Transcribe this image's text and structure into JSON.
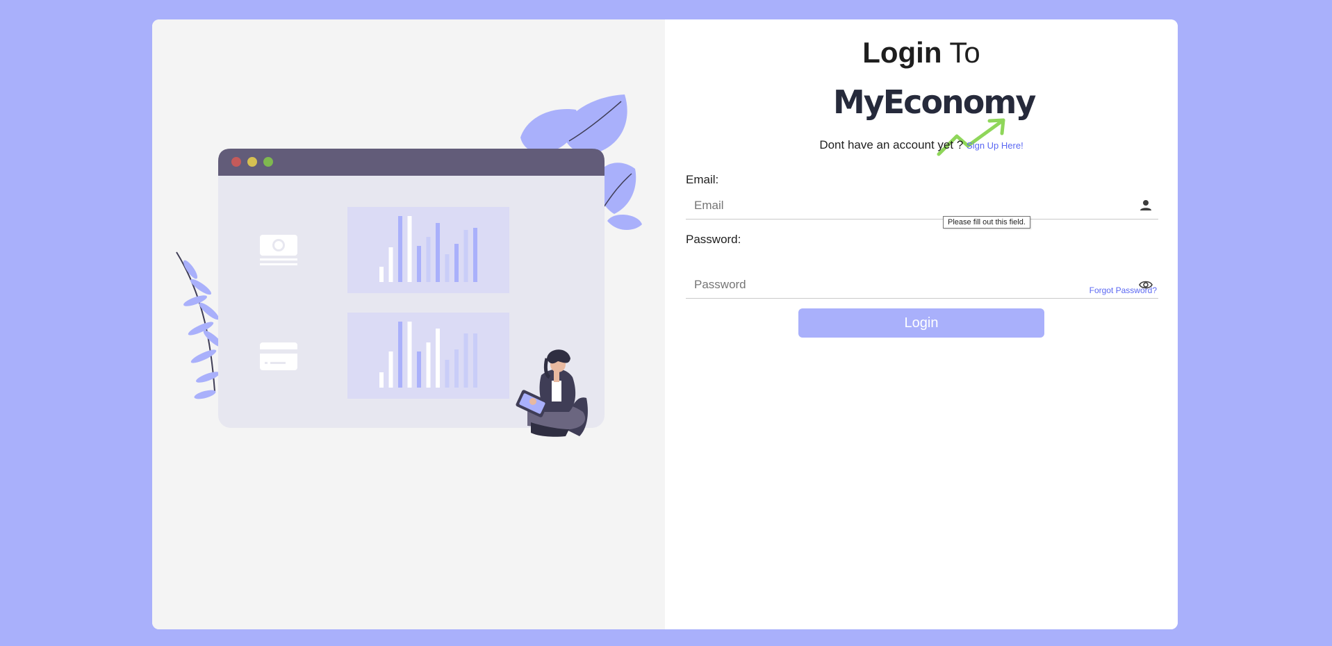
{
  "heading": {
    "bold": "Login",
    "regular": "To"
  },
  "logo": {
    "text": "MyEconomy",
    "arrow_color": "#8fd65a"
  },
  "signup": {
    "prompt": "Dont have an account yet ?",
    "link_label": "Sign Up Here!"
  },
  "email": {
    "label": "Email:",
    "placeholder": "Email",
    "value": "",
    "icon": "person-icon"
  },
  "validation": {
    "tooltip": "Please fill out this field."
  },
  "password": {
    "label": "Password:",
    "placeholder": "Password",
    "value": "",
    "icon": "eye-icon"
  },
  "forgot_label": "Forgot Password?",
  "login_label": "Login",
  "colors": {
    "background": "#a9b0fb",
    "accent": "#a9b0fb",
    "link": "#5a67f2",
    "panel_left": "#f4f4f4",
    "window_bar": "#625c79"
  }
}
